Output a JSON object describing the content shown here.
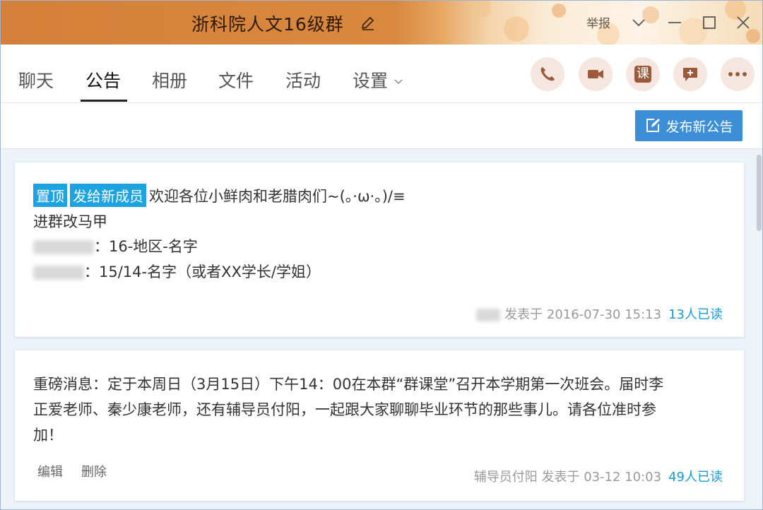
{
  "title_bar": {
    "group_name": "浙科院人文16级群",
    "report_label": "举报"
  },
  "tabs": [
    {
      "label": "聊天"
    },
    {
      "label": "公告"
    },
    {
      "label": "相册"
    },
    {
      "label": "文件"
    },
    {
      "label": "活动"
    },
    {
      "label": "设置"
    }
  ],
  "quick_actions": {
    "course_label": "课"
  },
  "toolbar": {
    "publish_label": "发布新公告"
  },
  "notices": [
    {
      "tags": [
        "置顶",
        "发给新成员"
      ],
      "lines": [
        "欢迎各位小鲜肉和老腊肉们~(。·ω·。)/≡",
        "进群改马甲",
        "：16-地区-名字",
        "：15/14-名字（或者XX学长/学姐）"
      ],
      "meta_posted": "发表于 2016-07-30 15:13",
      "read_count": "13人已读"
    },
    {
      "lines": [
        "重磅消息：定于本周日（3月15日）下午14：00在本群“群课堂”召开本学期第一次班会。届时李",
        "正爱老师、秦少康老师，还有辅导员付阳，一起跟大家聊聊毕业环节的那些事儿。请各位准时参",
        "加！"
      ],
      "edit_label": "编辑",
      "delete_label": "删除",
      "meta_posted": "辅导员付阳 发表于 03-12 10:03",
      "read_count": "49人已读"
    }
  ],
  "colors": {
    "title_orange": "#d5803a",
    "accent_blue": "#3c8fd6",
    "tag_blue": "#1ea3e2",
    "read_blue": "#1b9ad6",
    "icon_brown": "#9b5a3c"
  }
}
